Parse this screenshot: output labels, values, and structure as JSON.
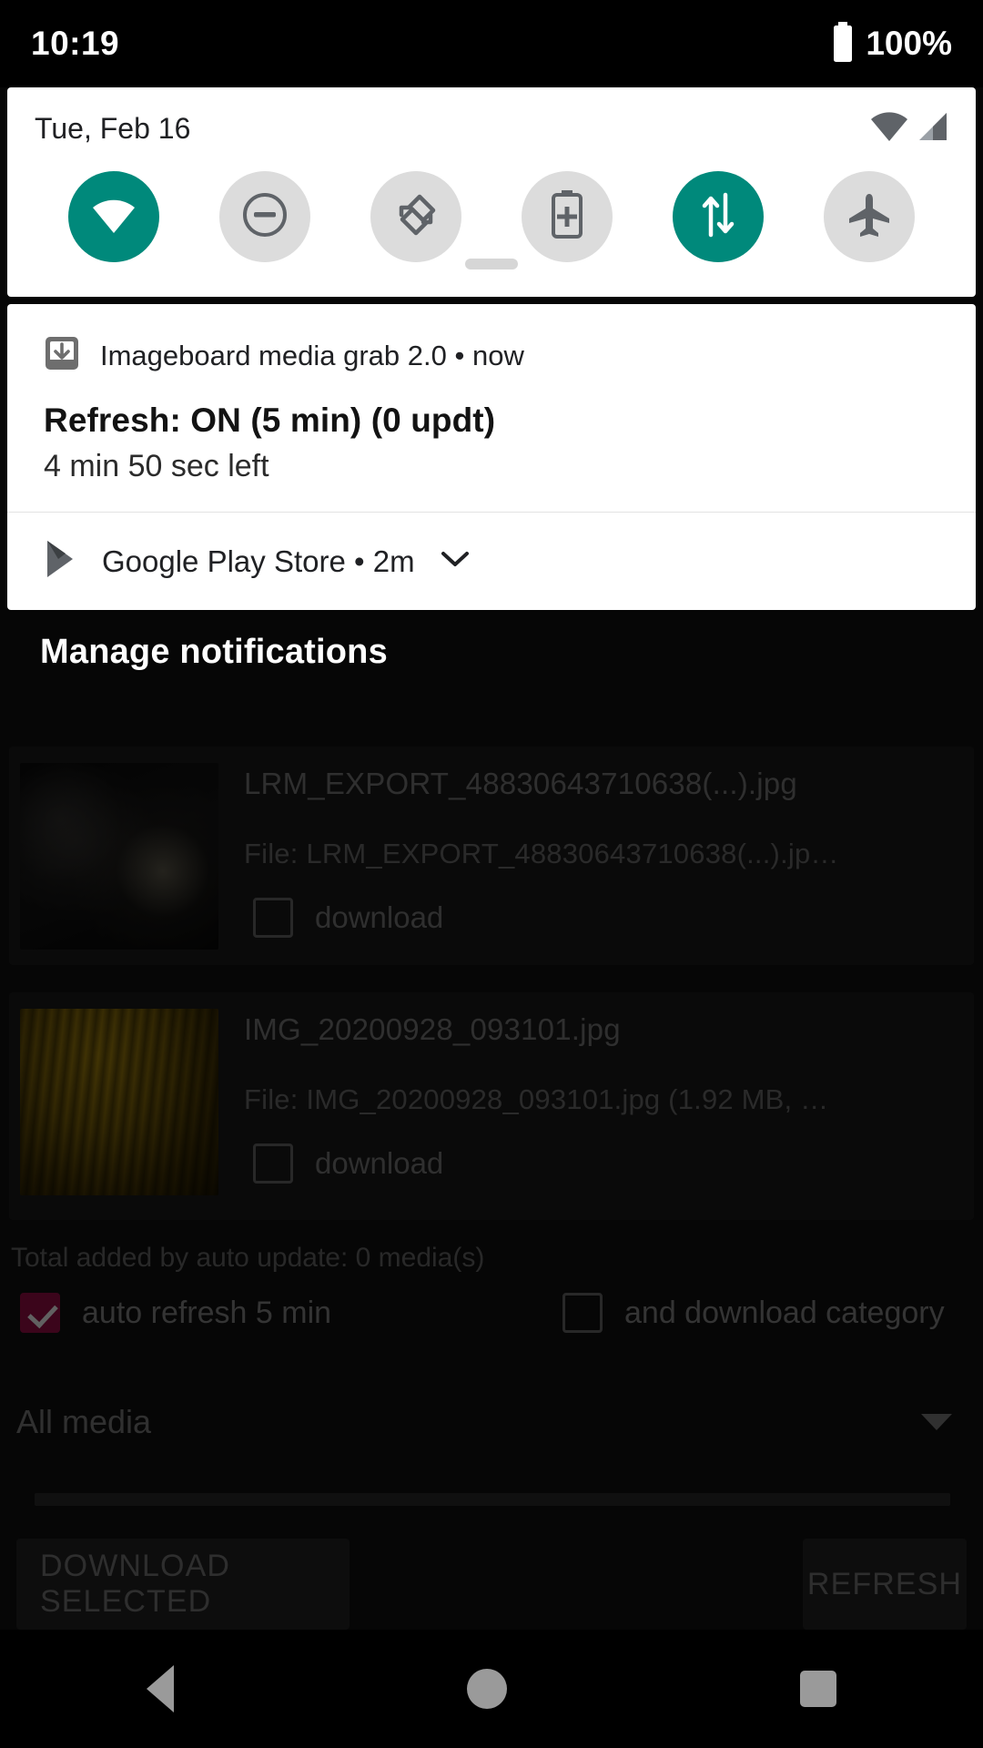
{
  "statusbar": {
    "time": "10:19",
    "battery_percent": "100%",
    "battery_icon": "battery-full-icon"
  },
  "quick_settings": {
    "date": "Tue, Feb 16",
    "signal_icons": [
      "wifi-signal-icon",
      "cellular-signal-icon"
    ],
    "accent_on_color": "#00897b",
    "tile_off_color": "#dcdcdc",
    "tiles": [
      {
        "name": "wifi",
        "icon": "wifi-icon",
        "state": "on"
      },
      {
        "name": "do-not-disturb",
        "icon": "do-not-disturb-icon",
        "state": "off"
      },
      {
        "name": "auto-rotate",
        "icon": "auto-rotate-icon",
        "state": "off"
      },
      {
        "name": "battery-saver",
        "icon": "battery-saver-icon",
        "state": "off"
      },
      {
        "name": "mobile-data",
        "icon": "mobile-data-icon",
        "state": "on"
      },
      {
        "name": "airplane-mode",
        "icon": "airplane-icon",
        "state": "off"
      }
    ]
  },
  "notifications": {
    "primary": {
      "app_icon": "download-icon",
      "app_name": "Imageboard media grab 2.0",
      "time": "now",
      "separator": "•",
      "title": "Refresh: ON (5 min) (0 updt)",
      "subtitle": "4 min 50 sec left"
    },
    "secondary": {
      "app_icon": "google-play-icon",
      "app_name": "Google Play Store",
      "time": "2m",
      "separator": "•",
      "expand_icon": "chevron-down-icon"
    },
    "manage_label": "Manage notifications"
  },
  "app": {
    "media_items": [
      {
        "title": "LRM_EXPORT_48830643710638(...).jpg",
        "file": "File: LRM_EXPORT_48830643710638(...).jp…",
        "checkbox_label": "download",
        "checked": false,
        "thumbnail": "night-scene-thumbnail"
      },
      {
        "title": "IMG_20200928_093101.jpg",
        "file": "File: IMG_20200928_093101.jpg (1.92 MB, …",
        "checkbox_label": "download",
        "checked": false,
        "thumbnail": "autumn-foliage-thumbnail"
      }
    ],
    "total_text": "Total added by auto update: 0 media(s)",
    "options": [
      {
        "label": "auto refresh 5 min",
        "checked": true,
        "color": "#9b0f48"
      },
      {
        "label": "and download category",
        "checked": false
      }
    ],
    "category_spinner": {
      "value": "All media",
      "icon": "caret-down-icon"
    },
    "buttons": {
      "download_selected": "DOWNLOAD SELECTED",
      "refresh": "REFRESH"
    }
  },
  "navbar": {
    "back": "back-icon",
    "home": "home-icon",
    "recents": "recents-icon"
  }
}
